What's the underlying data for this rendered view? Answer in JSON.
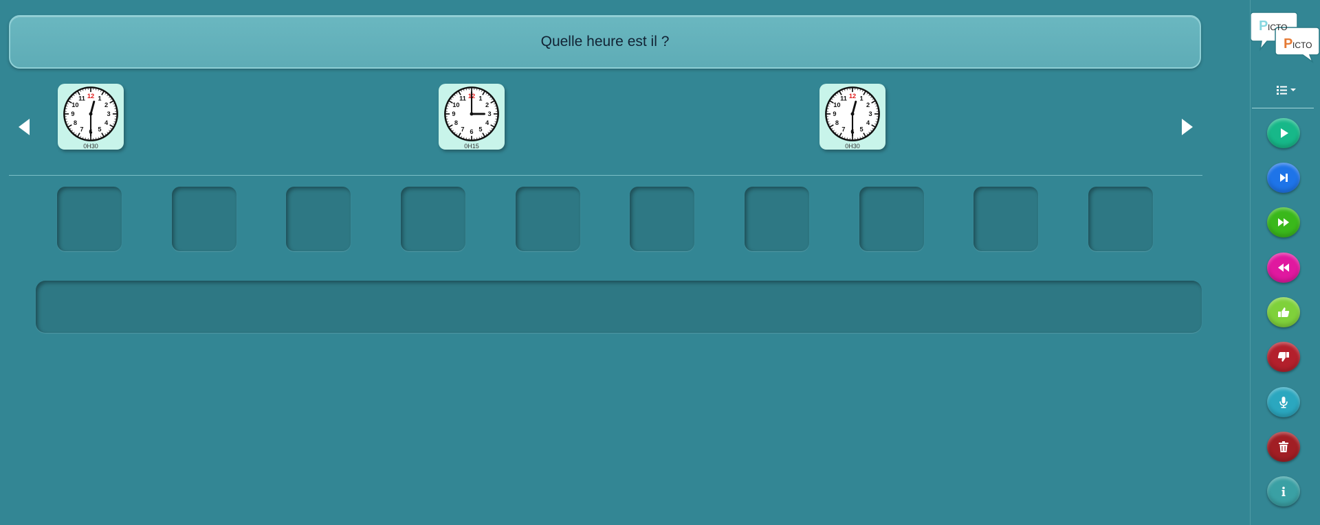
{
  "question": {
    "text": "Quelle heure est il ?"
  },
  "strip": {
    "cards": [
      {
        "caption": "0H30",
        "icon": "clock-icon"
      },
      {
        "caption": "0H15",
        "icon": "clock-icon"
      },
      {
        "caption": "0H30",
        "icon": "clock-icon"
      }
    ]
  },
  "answer_slots": {
    "count": 10
  },
  "logo": {
    "line1": "PICTO",
    "line2": "PICTO"
  },
  "sidebar": {
    "menu_icon": "list-menu-icon",
    "buttons": [
      {
        "name": "play-button",
        "icon": "play-icon",
        "color": "#17b889"
      },
      {
        "name": "next-button",
        "icon": "step-forward-icon",
        "color": "#1e74e8"
      },
      {
        "name": "fast-forward-button",
        "icon": "fast-forward-icon",
        "color": "#3ab81b"
      },
      {
        "name": "rewind-button",
        "icon": "rewind-icon",
        "color": "#e0189f"
      },
      {
        "name": "thumbs-up-button",
        "icon": "thumbs-up-icon",
        "color": "#7fd13b"
      },
      {
        "name": "thumbs-down-button",
        "icon": "thumbs-down-icon",
        "color": "#b3202c"
      },
      {
        "name": "microphone-button",
        "icon": "microphone-icon",
        "color": "#2ba7bf"
      },
      {
        "name": "delete-button",
        "icon": "trash-icon",
        "color": "#a11e24"
      },
      {
        "name": "info-button",
        "icon": "info-icon",
        "color": "#3aa0a4"
      }
    ]
  },
  "colors": {
    "background": "#338694",
    "question_bar": "#62b0ba",
    "card": "#c8f4ea",
    "slot": "#2e7884"
  }
}
